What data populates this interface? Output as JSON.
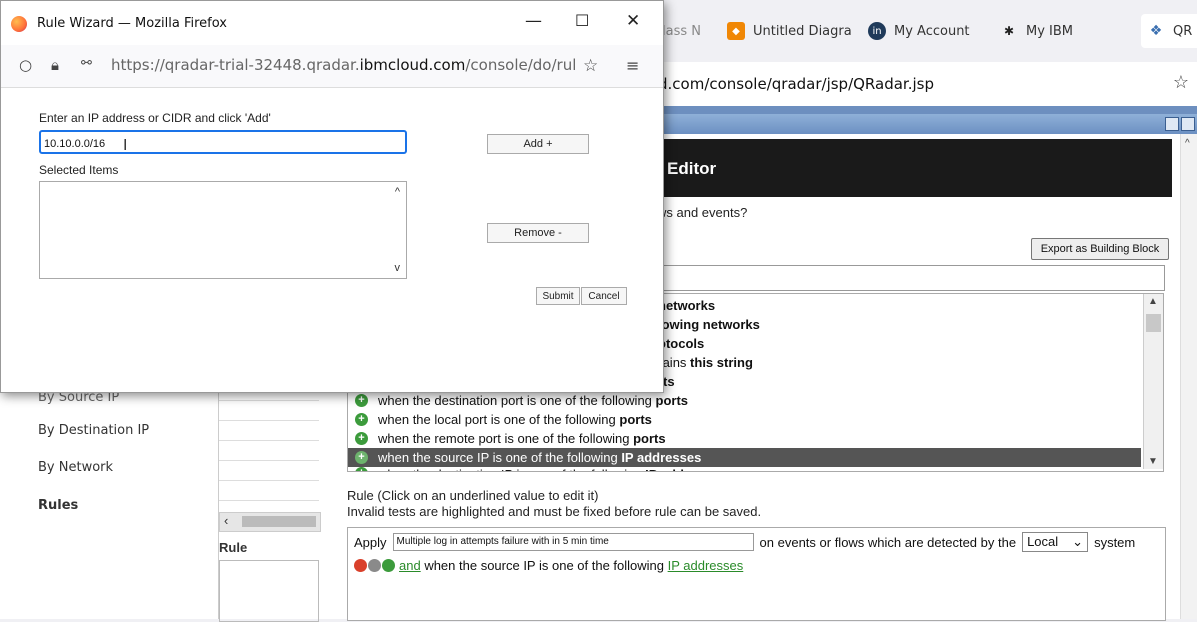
{
  "browser": {
    "tabs": [
      {
        "label": "lass N",
        "icon": ""
      },
      {
        "label": "Untitled Diagra",
        "icon": "drawio-icon"
      },
      {
        "label": "My Account",
        "icon": "in"
      },
      {
        "label": "My IBM",
        "icon": "ibm-icon"
      },
      {
        "label": "QR",
        "icon": "qradar-icon"
      }
    ],
    "url_prefix": "d.com/console/qradar/jsp/QRadar.jsp"
  },
  "qradar": {
    "editor_title": "Editor",
    "question": "ws and events?",
    "export_label": "Export as Building Block",
    "tests": [
      {
        "pre": "",
        "bold": "networks",
        "post": ""
      },
      {
        "pre": "",
        "bold": "lowing networks",
        "post": ""
      },
      {
        "pre": "",
        "bold": "otocols",
        "post": ""
      },
      {
        "pre": "contains ",
        "bold": "this string",
        "post": ""
      },
      {
        "pre": "",
        "bold": "rts",
        "post": ""
      },
      {
        "pre": "when the destination port is one of the following ",
        "bold": "ports",
        "post": ""
      },
      {
        "pre": "when the local port is one of the following ",
        "bold": "ports",
        "post": ""
      },
      {
        "pre": "when the remote port is one of the following ",
        "bold": "ports",
        "post": ""
      },
      {
        "pre": "when the source IP is one of the following ",
        "bold": "IP addresses",
        "post": ""
      },
      {
        "pre": "when the destination IP is one of the following ",
        "bold": "IP addresses",
        "post": ""
      }
    ],
    "rule_caption_1": "Rule (Click on an underlined value to edit it)",
    "rule_caption_2": "Invalid tests are highlighted and must be fixed before rule can be saved.",
    "apply_label": "Apply",
    "rule_name_value": "Multiple log in attempts failure with in 5 min time",
    "detected_text": "on events or flows which are detected by the",
    "system_select": "Local",
    "system_label": "system",
    "and_label": "and",
    "condition_text": " when the source IP is one of the following ",
    "condition_link": "IP addresses",
    "nav": {
      "by_source": "By Source IP",
      "by_destination": "By Destination IP",
      "by_network": "By Network",
      "rules": "Rules"
    },
    "rule_column_label": "Rule"
  },
  "popup": {
    "title": "Rule Wizard — Mozilla Firefox",
    "url_pre": "https://qradar-trial-32448.qradar.",
    "url_domain": "ibmcloud.com",
    "url_post": "/console/do/rulewiz",
    "ip_label": "Enter an IP address or CIDR and click 'Add'",
    "ip_value": "10.10.0.0/16",
    "add_label": "Add +",
    "selected_label": "Selected Items",
    "remove_label": "Remove -",
    "submit_label": "Submit",
    "cancel_label": "Cancel"
  }
}
